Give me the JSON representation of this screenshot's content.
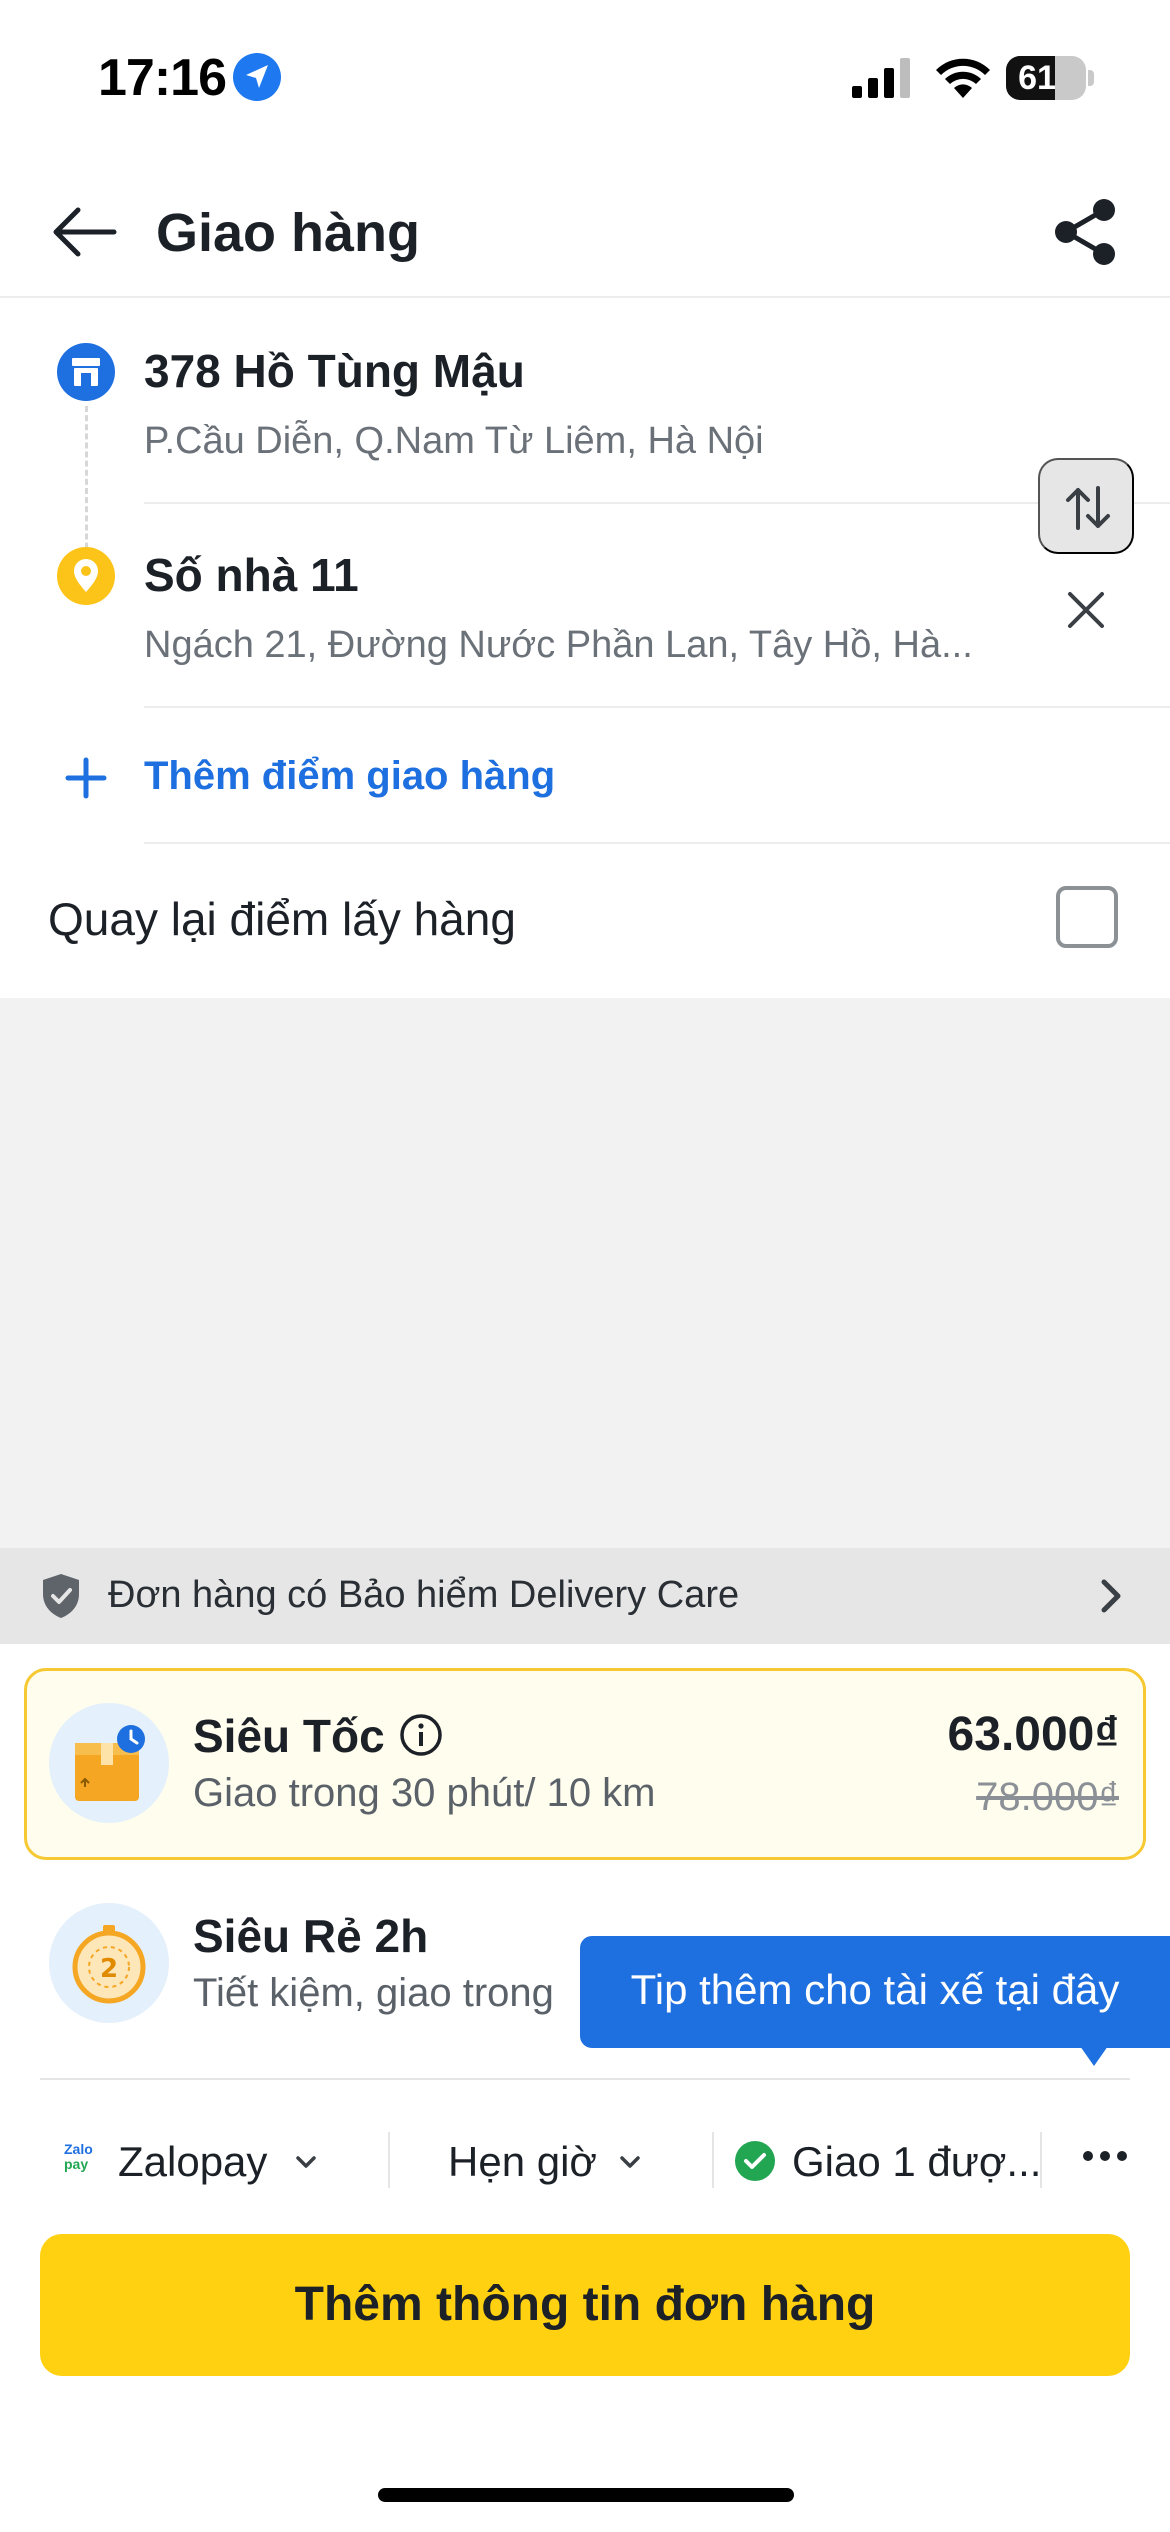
{
  "status_bar": {
    "time": "17:16",
    "battery_percent": 61,
    "battery_label": "61"
  },
  "header": {
    "title": "Giao hàng"
  },
  "route": {
    "pickup": {
      "title": "378 Hồ Tùng Mậu",
      "subtitle": "P.Cầu Diễn, Q.Nam Từ Liêm, Hà Nội"
    },
    "dropoff": {
      "title": "Số nhà 11",
      "subtitle": "Ngách 21, Đường Nước Phần Lan, Tây Hồ, Hà..."
    },
    "add_stop_label": "Thêm điểm giao hàng",
    "return_label": "Quay lại điểm lấy hàng",
    "return_checked": false
  },
  "insurance": {
    "text": "Đơn hàng có Bảo hiểm Delivery Care"
  },
  "options": [
    {
      "title": "Siêu Tốc",
      "subtitle": "Giao trong 30 phút/ 10 km",
      "price": "63.000₫",
      "old_price": "78.000₫",
      "selected": true
    },
    {
      "title": "Siêu Rẻ 2h",
      "subtitle": "Tiết kiệm, giao trong",
      "selected": false
    }
  ],
  "tooltip": {
    "text": "Tip thêm cho tài xế tại đây"
  },
  "toolbar": {
    "payment_logo_top": "Zalo",
    "payment_logo_bottom": "pay",
    "payment_label": "Zalopay",
    "schedule_label": "Hẹn giờ",
    "delivery_label": "Giao 1 đượ..."
  },
  "cta": {
    "label": "Thêm thông tin đơn hàng"
  },
  "colors": {
    "accent_blue": "#1e6fdf",
    "cta_yellow": "#ffd111",
    "selected_border": "#f6c933",
    "selected_bg": "#fffdee",
    "check_green": "#22a652"
  }
}
